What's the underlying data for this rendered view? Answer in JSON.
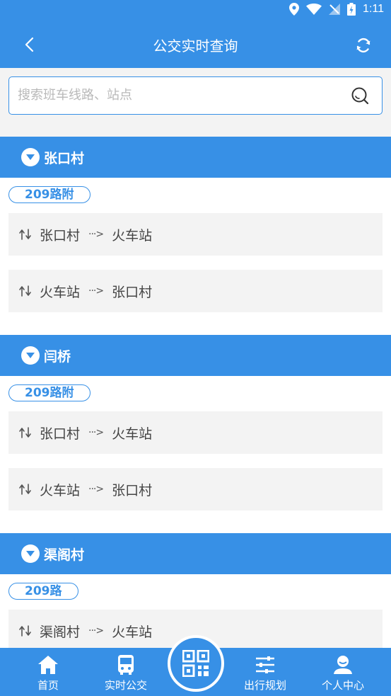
{
  "status": {
    "time": "1:11"
  },
  "header": {
    "title": "公交实时查询"
  },
  "search": {
    "placeholder": "搜索班车线路、站点"
  },
  "stops": [
    {
      "name": "张口村",
      "route": "209路附",
      "directions": [
        {
          "from": "张口村",
          "to": "火车站"
        },
        {
          "from": "火车站",
          "to": "张口村"
        }
      ]
    },
    {
      "name": "闫桥",
      "route": "209路附",
      "directions": [
        {
          "from": "张口村",
          "to": "火车站"
        },
        {
          "from": "火车站",
          "to": "张口村"
        }
      ]
    },
    {
      "name": "渠阁村",
      "route": "209路",
      "directions": [
        {
          "from": "渠阁村",
          "to": "火车站"
        }
      ]
    }
  ],
  "nav": {
    "home": "首页",
    "realtime_bus": "实时公交",
    "trip_planning": "出行规划",
    "personal_center": "个人中心"
  },
  "colors": {
    "accent": "#3790e6",
    "background_gray": "#f3f3f3"
  }
}
